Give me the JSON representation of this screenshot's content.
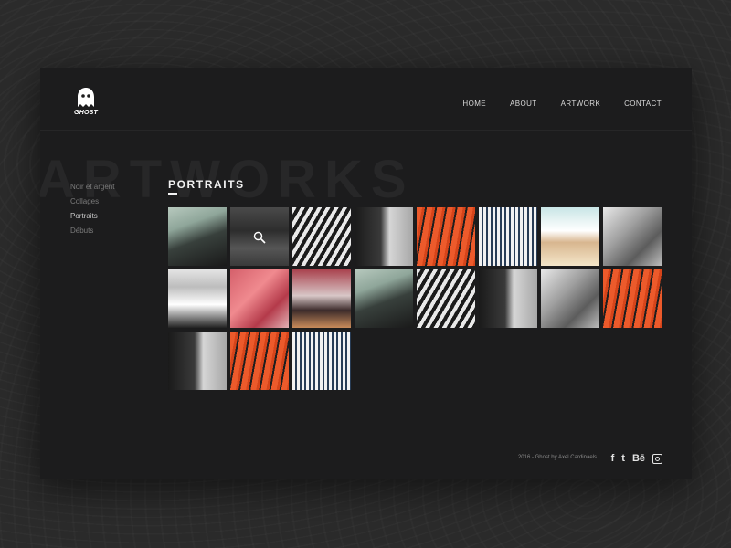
{
  "brand": {
    "name": "GHOST"
  },
  "nav": [
    {
      "label": "HOME",
      "active": false
    },
    {
      "label": "ABOUT",
      "active": false
    },
    {
      "label": "ARTWORK",
      "active": true
    },
    {
      "label": "CONTACT",
      "active": false
    }
  ],
  "background_title": "ARTWORKS",
  "side_menu": [
    {
      "label": "Noir et argent",
      "active": false
    },
    {
      "label": "Collages",
      "active": false
    },
    {
      "label": "Portraits",
      "active": true
    },
    {
      "label": "Débuts",
      "active": false
    }
  ],
  "section": {
    "title": "PORTRAITS"
  },
  "gallery": [
    {
      "style": "t-green"
    },
    {
      "style": "t-dark",
      "hover": true
    },
    {
      "style": "t-bw"
    },
    {
      "style": "t-studio"
    },
    {
      "style": "t-orange"
    },
    {
      "style": "t-sketch"
    },
    {
      "style": "t-color"
    },
    {
      "style": "t-photo"
    },
    {
      "style": "t-bun"
    },
    {
      "style": "t-pink"
    },
    {
      "style": "t-gallery"
    },
    {
      "style": "t-green"
    },
    {
      "style": "t-bw"
    },
    {
      "style": "t-studio"
    },
    {
      "style": "t-photo"
    },
    {
      "style": "t-orange"
    },
    {
      "style": "t-studio"
    },
    {
      "style": "t-orange"
    },
    {
      "style": "t-sketch"
    }
  ],
  "footer": {
    "credit": "2016 - Ghost by Axel Cardinaels",
    "social": [
      {
        "icon": "facebook-icon",
        "glyph": "f"
      },
      {
        "icon": "tumblr-icon",
        "glyph": "t"
      },
      {
        "icon": "behance-icon",
        "glyph": "Bē"
      },
      {
        "icon": "instagram-icon",
        "glyph": ""
      }
    ]
  },
  "colors": {
    "background": "#2b2b2b",
    "panel": "#1c1c1d",
    "accent": "#f2f2f2",
    "orange": "#ec5a2b"
  }
}
